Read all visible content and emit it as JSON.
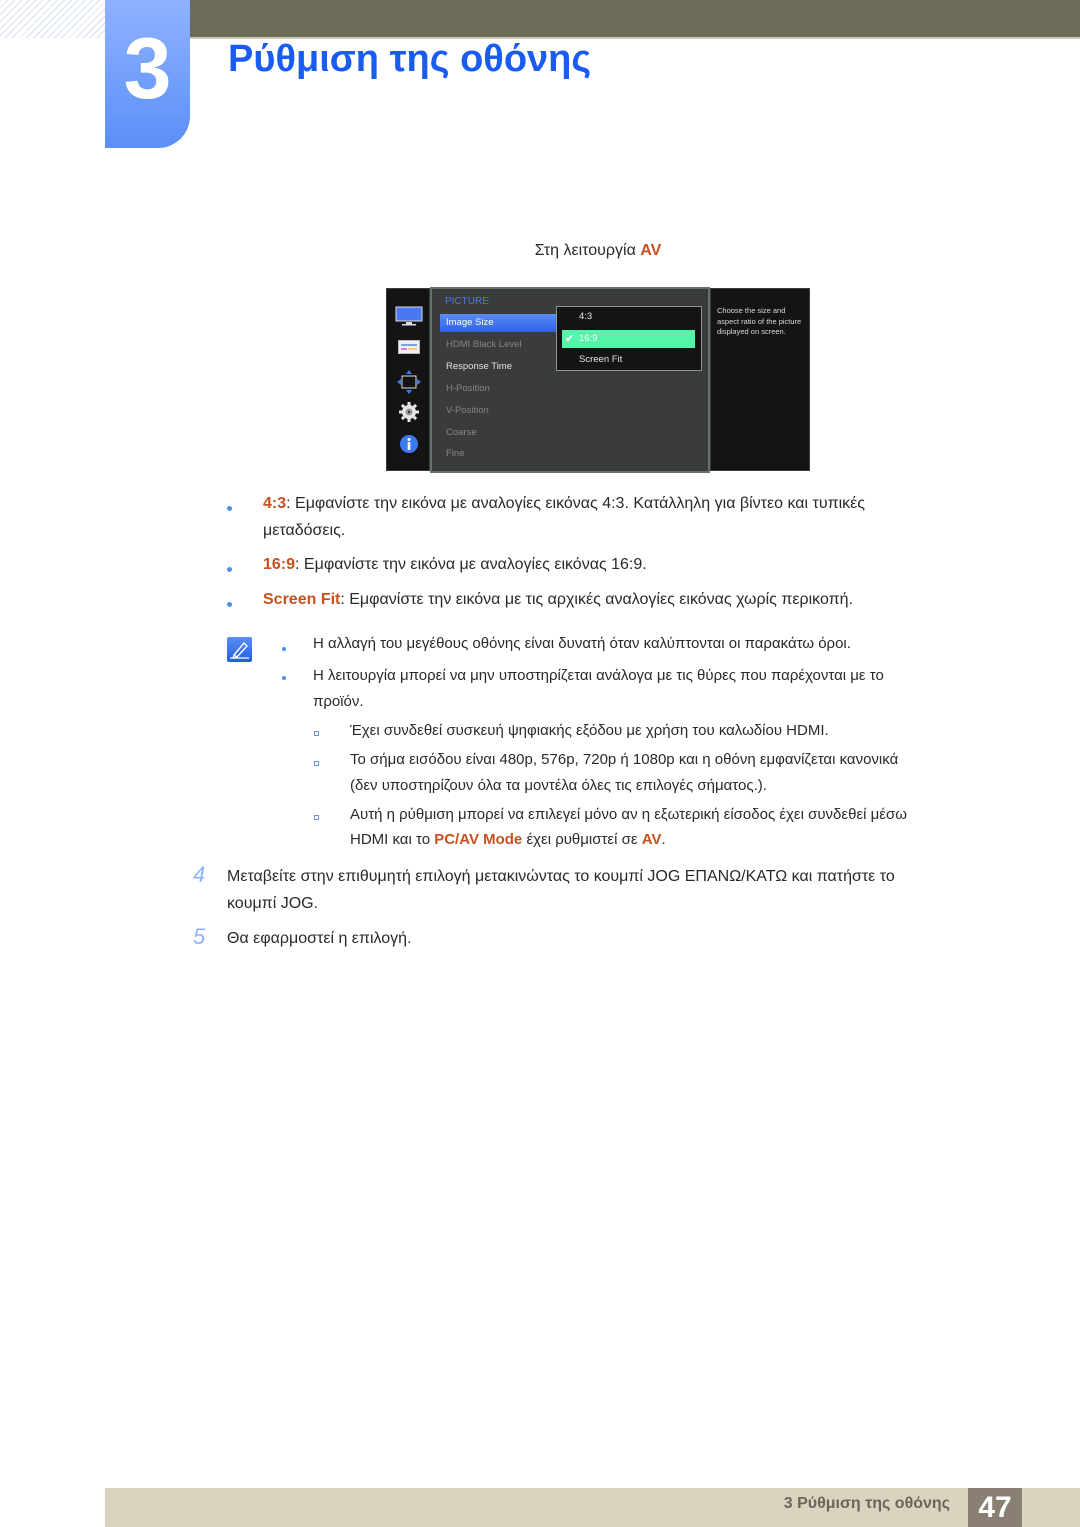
{
  "header": {
    "chapter_number": "3",
    "chapter_title": "Ρύθμιση της οθόνης"
  },
  "caption": {
    "text": "Στη λειτουργία ",
    "accent": "AV"
  },
  "osd": {
    "side_icons": [
      "monitor-icon",
      "picture-settings-icon",
      "position-arrows-icon",
      "gear-icon",
      "info-icon"
    ],
    "menu_title": "PICTURE",
    "menu_items": [
      {
        "label": "Image Size",
        "state": "active"
      },
      {
        "label": "HDMI Black Level",
        "state": "disabled"
      },
      {
        "label": "Response Time",
        "state": "enabled"
      },
      {
        "label": "H-Position",
        "state": "disabled"
      },
      {
        "label": "V-Position",
        "state": "disabled"
      },
      {
        "label": "Coarse",
        "state": "disabled"
      },
      {
        "label": "Fine",
        "state": "disabled"
      }
    ],
    "submenu_items": [
      {
        "label": "4:3",
        "selected": false
      },
      {
        "label": "16:9",
        "selected": true
      },
      {
        "label": "Screen Fit",
        "selected": false
      }
    ],
    "help_text": "Choose the size and aspect ratio of the picture displayed on screen.",
    "colors": {
      "active_item": "#2f62e6",
      "selected_option": "#55f5a9",
      "title": "#5577ee"
    }
  },
  "bullets": [
    {
      "term": "4:3",
      "text": ": Εμφανίστε την εικόνα με αναλογίες εικόνας 4:3. Κατάλληλη για βίντεο και τυπικές",
      "cont": "μεταδόσεις."
    },
    {
      "term": "16:9",
      "text": ": Εμφανίστε την εικόνα με αναλογίες εικόνας 16:9."
    },
    {
      "term": "Screen Fit",
      "text": ": Εμφανίστε την εικόνα με τις αρχικές αναλογίες εικόνας χωρίς περικοπή."
    }
  ],
  "note": {
    "icon": "note-pencil-icon",
    "items": [
      {
        "text": "Η αλλαγή του μεγέθους οθόνης είναι δυνατή όταν καλύπτονται οι παρακάτω όροι."
      },
      {
        "text": "Η λειτουργία μπορεί να μην υποστηρίζεται ανάλογα με τις θύρες που παρέχονται με το",
        "cont": "προϊόν."
      }
    ],
    "subitems": [
      {
        "text": "Έχει συνδεθεί συσκευή ψηφιακής εξόδου με χρήση του καλωδίου HDMI."
      },
      {
        "text": "Το σήμα εισόδου είναι 480p, 576p, 720p ή 1080p και η οθόνη εμφανίζεται κανονικά",
        "cont": "(δεν υποστηρίζουν όλα τα μοντέλα όλες τις επιλογές σήματος.)."
      },
      {
        "text": "Αυτή η ρύθμιση μπορεί να επιλεγεί μόνο αν η εξωτερική είσοδος έχει συνδεθεί μέσω",
        "cont_pre": "HDMI και το ",
        "cont_hl1": "PC/AV Mode",
        "cont_mid": " έχει ρυθμιστεί σε ",
        "cont_hl2": "AV",
        "cont_post": "."
      }
    ]
  },
  "steps": [
    {
      "num": "4",
      "text": "Μεταβείτε στην επιθυμητή επιλογή μετακινώντας το κουμπί JOG ΕΠΑΝΩ/ΚΑΤΩ και πατήστε το",
      "cont": "κουμπί JOG."
    },
    {
      "num": "5",
      "text": "Θα εφαρμοστεί η επιλογή."
    }
  ],
  "footer": {
    "title": "3 Ρύθμιση της οθόνης",
    "page": "47"
  }
}
